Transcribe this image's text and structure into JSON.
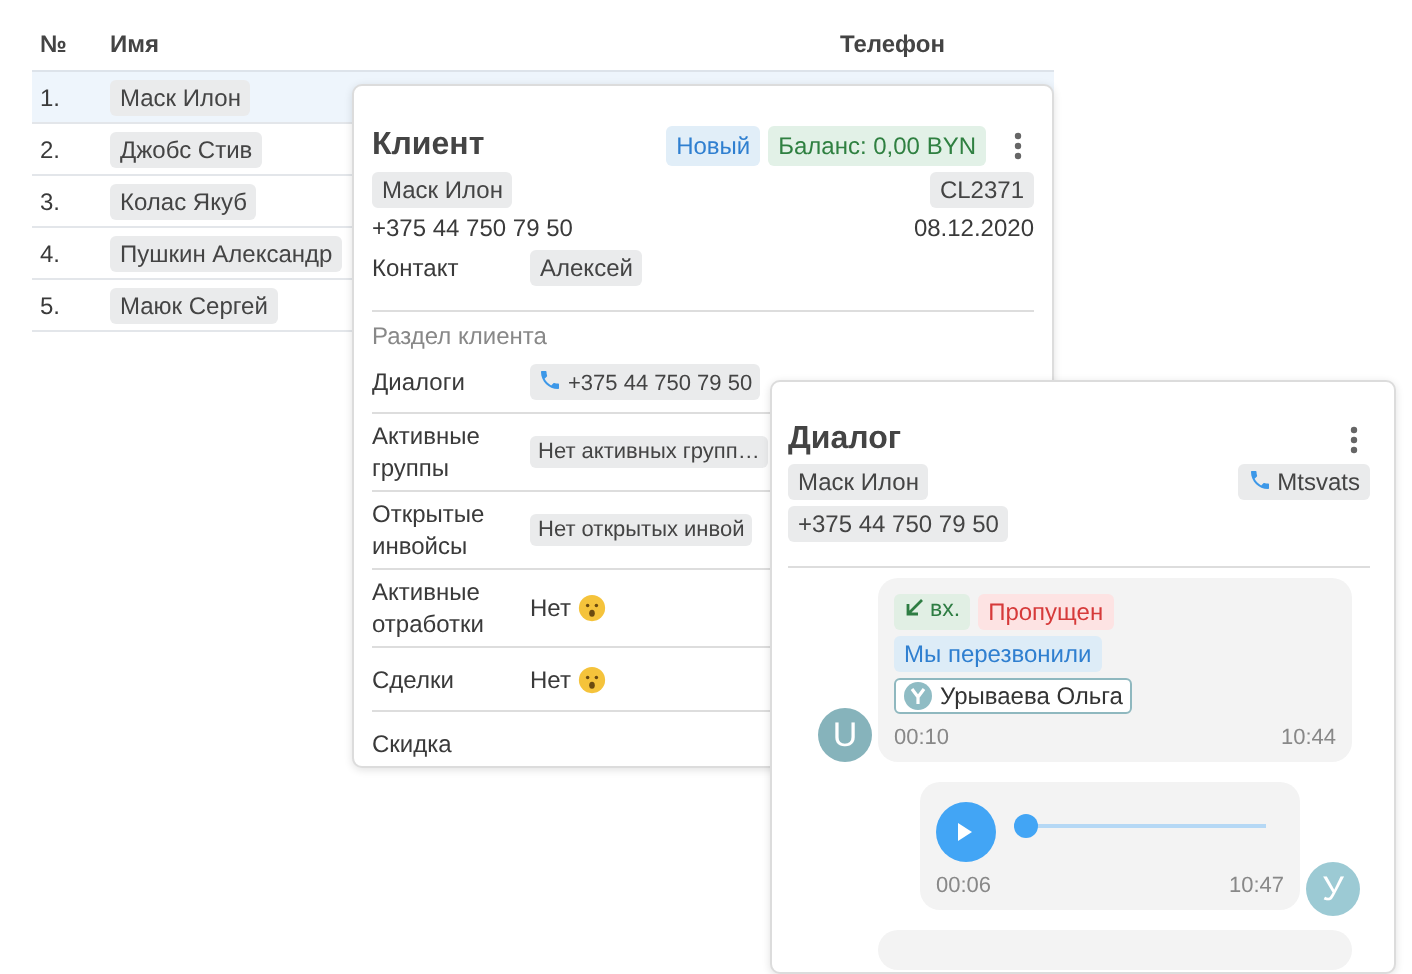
{
  "table": {
    "columns": [
      "№",
      "Имя",
      "Телефон"
    ],
    "rows": [
      {
        "number": "1.",
        "name": "Маск Илон",
        "selected": true
      },
      {
        "number": "2.",
        "name": "Джобс Стив",
        "selected": false
      },
      {
        "number": "3.",
        "name": "Колас Якуб",
        "selected": false
      },
      {
        "number": "4.",
        "name": "Пушкин Александр",
        "selected": false
      },
      {
        "number": "5.",
        "name": "Маюк Сергей",
        "selected": false
      }
    ]
  },
  "client_card": {
    "title": "Клиент",
    "badges": [
      {
        "kind": "status",
        "text": "Новый"
      },
      {
        "kind": "balance",
        "text": "Баланс: 0,00 BYN"
      }
    ],
    "name": "Маск Илон",
    "code": "CL2371",
    "phone": "+375 44 750 79 50",
    "date": "08.12.2020",
    "contact_label": "Контакт",
    "contact": "Алексей",
    "section_title": "Раздел клиента",
    "fields": [
      {
        "label": "Диалоги",
        "kind": "chips",
        "chips": [
          {
            "kind": "call",
            "text": "+375 44 750 79 50"
          }
        ]
      },
      {
        "label": "Активные группы",
        "kind": "chips",
        "chips": [
          {
            "kind": "plain",
            "text": "Нет активных групп…"
          }
        ]
      },
      {
        "label": "Открытые инвойсы",
        "kind": "chips",
        "chips": [
          {
            "kind": "plain",
            "text": "Нет открытых инвой"
          }
        ]
      },
      {
        "label": "Активные отработки",
        "kind": "none",
        "text": "Нет"
      },
      {
        "label": "Сделки",
        "kind": "none",
        "text": "Нет"
      },
      {
        "label": "Скидка",
        "kind": "blank"
      }
    ]
  },
  "dialog": {
    "title": "Диалог",
    "name": "Маск Илон",
    "phone": "+375 44 750 79 50",
    "channel": "Mtsvats",
    "messages": [
      {
        "kind": "call",
        "avatar": "U",
        "tags": [
          {
            "kind": "incoming",
            "text": "вх."
          },
          {
            "kind": "missed",
            "text": "Пропущен"
          },
          {
            "kind": "callback",
            "text": "Мы перезвонили"
          },
          {
            "kind": "operator",
            "text": "Урываева Ольга"
          }
        ],
        "duration": "00:10",
        "time": "10:44"
      },
      {
        "kind": "voice",
        "avatar": "У",
        "level": 0,
        "duration": "00:06",
        "time": "10:47"
      },
      {
        "kind": "partial"
      }
    ]
  }
}
